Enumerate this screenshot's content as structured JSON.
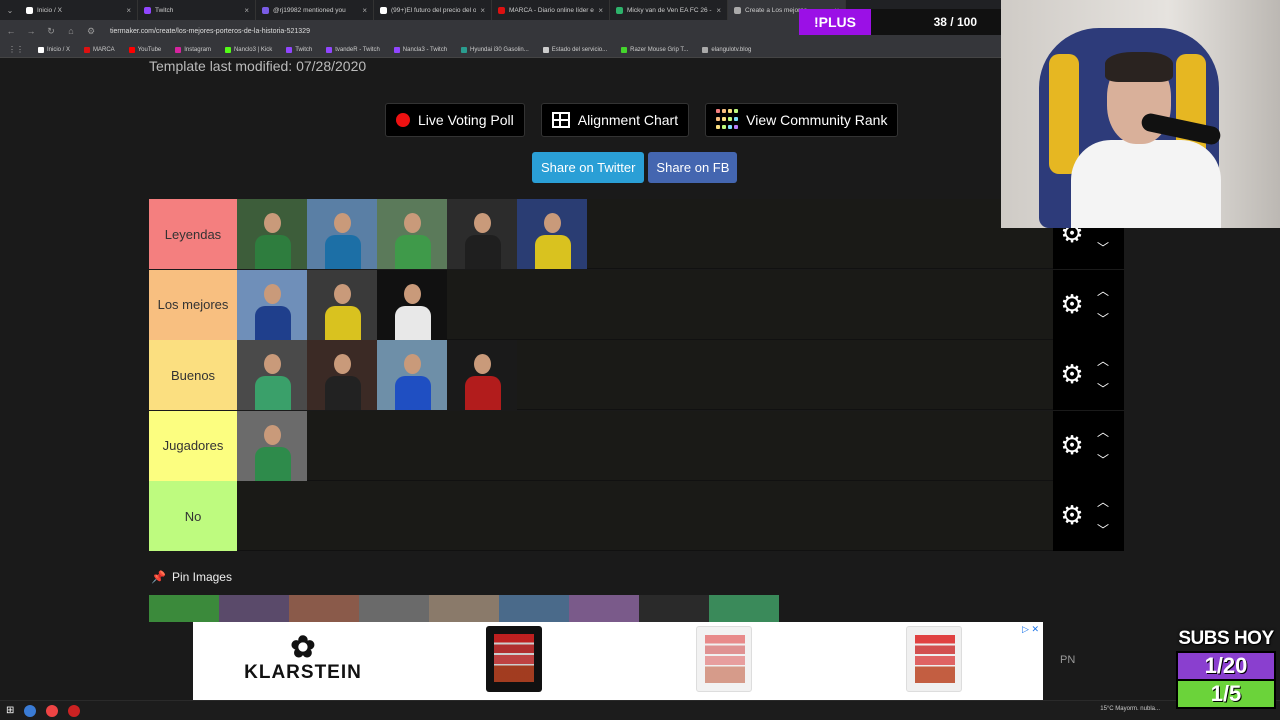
{
  "browser": {
    "tabs": [
      {
        "label": "Inicio / X",
        "fav": "#ffffff"
      },
      {
        "label": "Twitch",
        "fav": "#9146ff"
      },
      {
        "label": "@rj19982 mentioned you",
        "fav": "#7a5ce6"
      },
      {
        "label": "(99+)El futuro del precio del or",
        "fav": "#ffffff"
      },
      {
        "label": "MARCA - Diario online líder en",
        "fav": "#d11"
      },
      {
        "label": "Micky van de Ven EA FC 26 - E",
        "fav": "#2db36b"
      },
      {
        "label": "Create a Los mejores",
        "fav": "#aaaaaa"
      }
    ],
    "url": "tiermaker.com/create/los-mejores-porteros-de-la-historia-521329",
    "bookmarks": [
      {
        "label": "Inicio / X",
        "color": "#ffffff"
      },
      {
        "label": "MARCA",
        "color": "#d11"
      },
      {
        "label": "YouTube",
        "color": "#f00"
      },
      {
        "label": "Instagram",
        "color": "#d6249f"
      },
      {
        "label": "Nanclo3 | Kick",
        "color": "#53fc18"
      },
      {
        "label": "Twitch",
        "color": "#9146ff"
      },
      {
        "label": "tvandeR - Twitch",
        "color": "#9146ff"
      },
      {
        "label": "Nancla3 - Twitch",
        "color": "#9146ff"
      },
      {
        "label": "Hyundai i30 Gasolin...",
        "color": "#2a9d8f"
      },
      {
        "label": "Estado del servicio...",
        "color": "#cccccc"
      },
      {
        "label": "Razer Mouse Grip T...",
        "color": "#44d62c"
      },
      {
        "label": "elangulotv.blog",
        "color": "#aaaaaa"
      }
    ]
  },
  "page": {
    "template_modified": "Template last modified: 07/28/2020",
    "buttons": {
      "live_voting": "Live Voting Poll",
      "alignment": "Alignment Chart",
      "community": "View Community Rank",
      "share_twitter": "Share on Twitter",
      "share_fb": "Share on FB"
    },
    "pin_images": "Pin Images"
  },
  "tiers": [
    {
      "label": "Leyendas",
      "color": "#f47f7f",
      "items": 5
    },
    {
      "label": "Los mejores",
      "color": "#f8bf80",
      "items": 3
    },
    {
      "label": "Buenos",
      "color": "#fbdf80",
      "items": 4
    },
    {
      "label": "Jugadores",
      "color": "#fcfe80",
      "items": 1
    },
    {
      "label": "No",
      "color": "#befb7f",
      "items": 0
    }
  ],
  "ad": {
    "brand": "KLARSTEIN",
    "logo": "✿",
    "pn": "PN"
  },
  "overlay": {
    "plus": "!PLUS",
    "counter": "38 / 100",
    "subs_title": "SUBS HOY",
    "subs_a": "1/20",
    "subs_b": "1/5"
  },
  "taskbar": {
    "weather": "15°C  Mayorm. nubla..."
  }
}
